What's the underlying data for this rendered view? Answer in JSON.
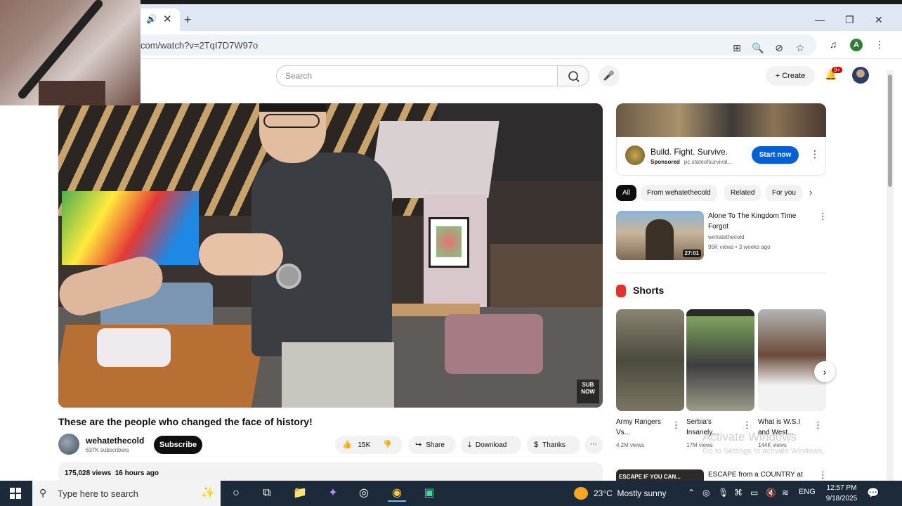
{
  "browser": {
    "tab_close": "✕",
    "tab_sound": "🔊",
    "new_tab": "+",
    "url": "com/watch?v=2TqI7D7W97o",
    "window_controls": {
      "minimize": "—",
      "maximize": "❐",
      "close": "✕"
    },
    "toolbar_icons": {
      "install": "⊞",
      "zoom": "🔍",
      "eye_off": "⊘",
      "star": "☆",
      "media": "♫",
      "profile_letter": "A",
      "menu": "⋮"
    }
  },
  "youtube": {
    "header": {
      "search_placeholder": "Search",
      "search_icon": "⚲",
      "mic_icon": "🎤",
      "create_label": "Create",
      "create_icon": "+",
      "bell_icon": "🔔",
      "notification_count": "9+"
    },
    "player": {
      "sub_badge": "SUB NOW"
    },
    "video": {
      "title": "These are the people who changed the face of history!",
      "channel": "wehatethecold",
      "subscribers": "637K subscribers",
      "subscribe_label": "Subscribe",
      "likes": "15K",
      "like_icon": "👍",
      "dislike_icon": "👎",
      "share_label": "Share",
      "share_icon": "↪",
      "download_label": "Download",
      "download_icon": "⤓",
      "thanks_label": "Thanks",
      "thanks_icon": "$",
      "more_icon": "⋯",
      "views": "175,028 views",
      "uploaded": "16 hours ago"
    },
    "ad": {
      "title": "Build. Fight. Survive.",
      "sponsored": "Sponsored",
      "domain": "pc.stateofsurvival...",
      "cta": "Start now",
      "more_icon": "⋮"
    },
    "chips": [
      "All",
      "From wehatethecold",
      "Related",
      "For you"
    ],
    "chip_next": "›",
    "recommended": {
      "title": "Alone To The Kingdom Time Forgot",
      "channel": "wehatethecold",
      "meta": "95K views • 3 weeks ago",
      "duration": "27:01",
      "more_icon": "⋮"
    },
    "shorts": {
      "heading": "Shorts",
      "items": [
        {
          "title": "Army Rangers Vs...",
          "views": "4.2M views"
        },
        {
          "title": "Serbia's Insanely...",
          "views": "17M views"
        },
        {
          "title": "What is W.S.I and West...",
          "views": "144K views"
        }
      ],
      "more_icon": "⋮",
      "next_icon": "›"
    },
    "recommended2": {
      "thumb_text": "ESCAPE IF YOU CAN...",
      "title": "ESCAPE from a COUNTRY at",
      "more_icon": "⋮"
    }
  },
  "watermark": {
    "title": "Activate Windows",
    "subtitle": "Go to Settings to activate Windows."
  },
  "taskbar": {
    "search_placeholder": "Type here to search",
    "search_icon": "⚲",
    "sparkle_icon": "✨",
    "apps": {
      "cortana": "○",
      "task_view": "⧉",
      "explorer": "📁",
      "copilot": "✦",
      "app_ring": "◎",
      "chrome": "◉",
      "media": "▣"
    },
    "weather_temp": "23°C",
    "weather_desc": "Mostly sunny",
    "tray": {
      "chevron": "⌃",
      "ring": "◎",
      "mic": "🎙",
      "meet": "⌘",
      "battery": "▭",
      "volume": "🔇",
      "wifi": "≋"
    },
    "language": "ENG",
    "time": "12:57 PM",
    "date": "9/18/2025",
    "notifications_icon": "💬"
  }
}
